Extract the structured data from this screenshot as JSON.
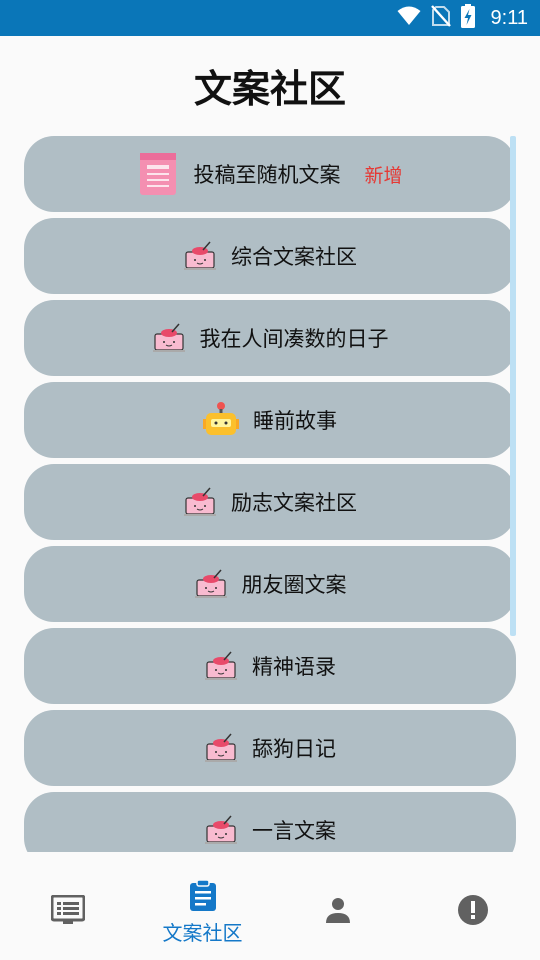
{
  "status_bar": {
    "time": "9:11",
    "icons": [
      "wifi-icon",
      "no-sim-icon",
      "battery-charging-icon"
    ]
  },
  "page": {
    "title": "文案社区"
  },
  "list": {
    "items": [
      {
        "label": "投稿至随机文案",
        "badge": "新增",
        "icon": "mailbox-icon"
      },
      {
        "label": "综合文案社区",
        "icon": "pink-cake-icon"
      },
      {
        "label": "我在人间凑数的日子",
        "icon": "pink-cake-icon"
      },
      {
        "label": "睡前故事",
        "icon": "robot-icon"
      },
      {
        "label": "励志文案社区",
        "icon": "pink-cake-icon"
      },
      {
        "label": "朋友圈文案",
        "icon": "pink-cake-icon"
      },
      {
        "label": "精神语录",
        "icon": "pink-cake-icon"
      },
      {
        "label": "舔狗日记",
        "icon": "pink-cake-icon"
      },
      {
        "label": "一言文案",
        "icon": "pink-cake-icon"
      }
    ]
  },
  "bottom_nav": {
    "active_index": 1,
    "active_color": "#1478c8",
    "inactive_color": "#616161",
    "items": [
      {
        "icon": "list-icon",
        "label": ""
      },
      {
        "icon": "clipboard-icon",
        "label": "文案社区"
      },
      {
        "icon": "person-icon",
        "label": ""
      },
      {
        "icon": "alert-circle-icon",
        "label": ""
      }
    ]
  },
  "colors": {
    "status_bar": "#0a76b8",
    "card_background": "#b0bec5",
    "badge": "#e53935"
  }
}
